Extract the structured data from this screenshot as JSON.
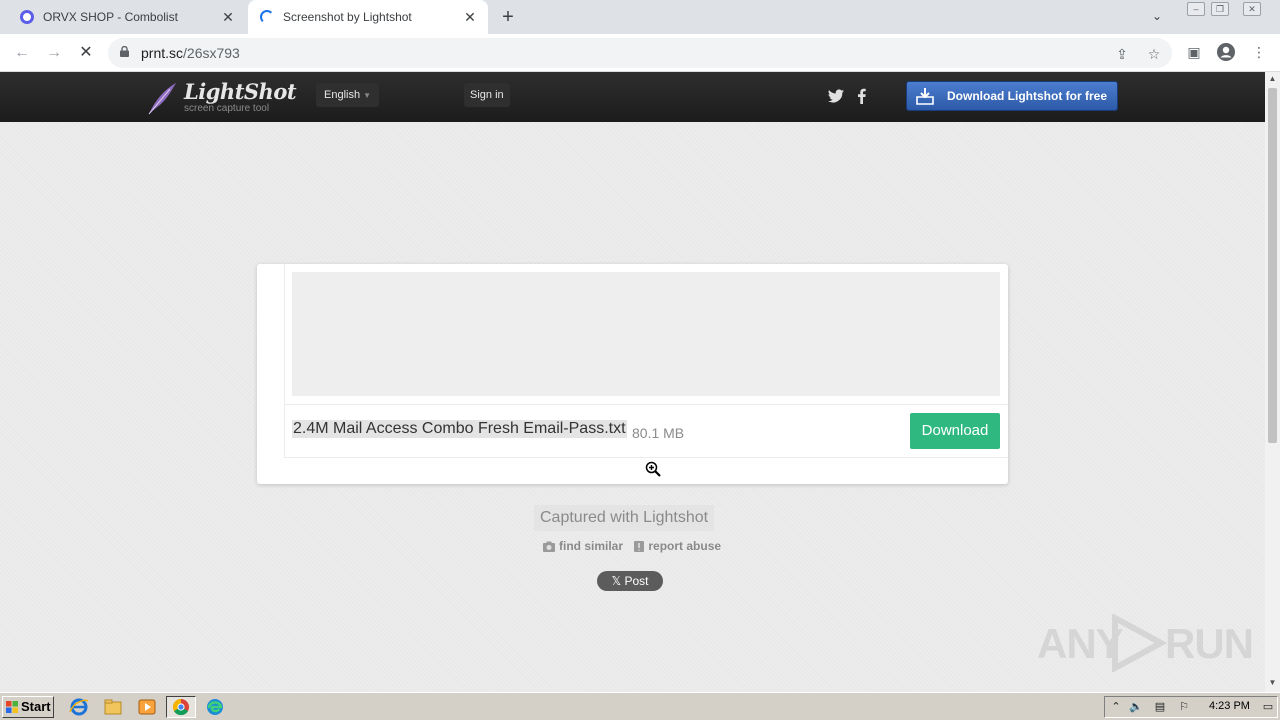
{
  "browser": {
    "tabs": [
      {
        "title": "ORVX SHOP - Combolist",
        "state": "inactive"
      },
      {
        "title": "Screenshot by Lightshot",
        "state": "active-loading"
      }
    ],
    "new_tab_label": "+",
    "address": {
      "host": "prnt.sc",
      "path": "/26sx793"
    },
    "icons": [
      "back-icon",
      "forward-icon",
      "stop-icon",
      "lock-icon",
      "share-icon",
      "bookmark-star-icon",
      "side-panel-icon",
      "profile-icon",
      "menu-icon"
    ]
  },
  "lightshot": {
    "logo_name": "LightShot",
    "logo_tagline": "screen capture tool",
    "language": "English",
    "sign_in": "Sign in",
    "download_cta": "Download Lightshot for free"
  },
  "screenshot": {
    "file_name": "2.4M Mail Access Combo Fresh Email-Pass.txt",
    "file_size": "80.1 MB",
    "download_label": "Download"
  },
  "footer": {
    "captured": "Captured with Lightshot",
    "find_similar": "find similar",
    "report_abuse": "report abuse",
    "post": "𝕏 Post"
  },
  "watermark": {
    "left": "ANY",
    "right": "RUN"
  },
  "taskbar": {
    "start_label": "Start",
    "clock": "4:23 PM"
  },
  "colors": {
    "download_green": "#2fb980",
    "cta_blue": "#3a6cc0",
    "header_dark": "#232323"
  }
}
